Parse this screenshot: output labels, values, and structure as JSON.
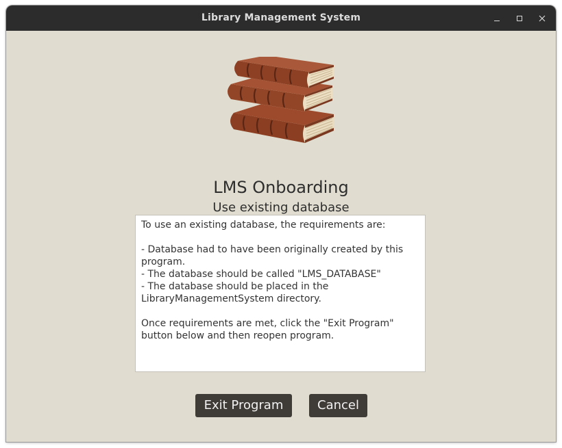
{
  "window": {
    "title": "Library Management System",
    "controls": {
      "minimize": "minimize-icon",
      "maximize": "maximize-icon",
      "close": "close-icon"
    }
  },
  "logo": {
    "icon": "books-stack-icon"
  },
  "onboarding": {
    "heading": "LMS Onboarding",
    "subheading": "Use existing database",
    "instructions": "To use an existing database, the requirements are:\n\n- Database had to have been originally created by this program.\n- The database should be called \"LMS_DATABASE\"\n- The database should be placed in the LibraryManagementSystem directory.\n\nOnce requirements are met, click the \"Exit Program\" button below and then reopen program."
  },
  "buttons": {
    "exit_label": "Exit Program",
    "cancel_label": "Cancel"
  },
  "colors": {
    "titlebar": "#2c2c2c",
    "background": "#e0ddd0",
    "button": "#3f3b36",
    "button_text": "#f2f2f2"
  }
}
